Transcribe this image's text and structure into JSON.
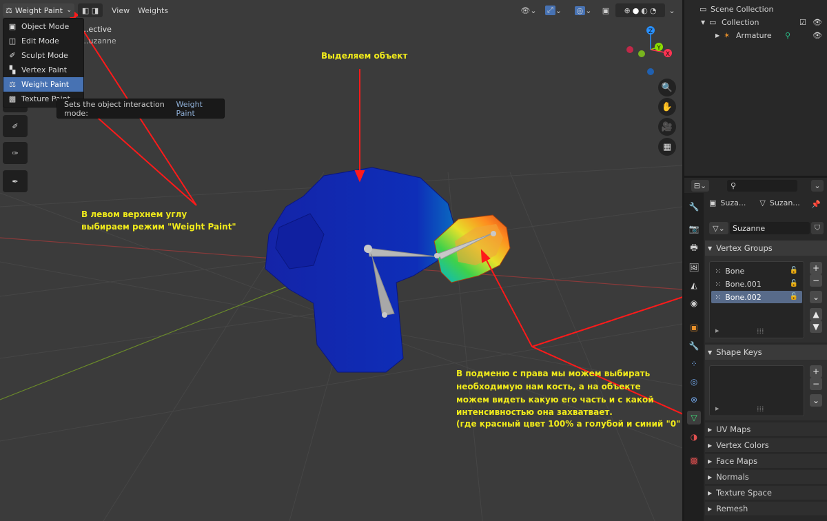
{
  "header": {
    "mode_label": "Weight Paint",
    "menus": [
      "View",
      "Weights"
    ]
  },
  "mode_menu": {
    "items": [
      {
        "label": "Object Mode",
        "icon": "object-mode-icon",
        "selected": false
      },
      {
        "label": "Edit Mode",
        "icon": "edit-mode-icon",
        "selected": false
      },
      {
        "label": "Sculpt Mode",
        "icon": "sculpt-mode-icon",
        "selected": false
      },
      {
        "label": "Vertex Paint",
        "icon": "vertex-paint-icon",
        "selected": false
      },
      {
        "label": "Weight Paint",
        "icon": "weight-paint-icon",
        "selected": true
      },
      {
        "label": "Texture Paint",
        "icon": "texture-paint-icon",
        "selected": false
      }
    ]
  },
  "tooltip": {
    "text": "Sets the object interaction mode:",
    "value": "Weight Paint"
  },
  "viewport_overlay": {
    "view_name": "...ective",
    "object_name": "...uzanne"
  },
  "gizmo": {
    "axes": [
      "Z",
      "Y",
      "X"
    ],
    "colors": {
      "x": "#ff3352",
      "y": "#8bdc00",
      "z": "#2890ff"
    }
  },
  "annotations": {
    "select_object": "Выделяем объект",
    "mode_hint_line1": "В левом верхнем углу",
    "mode_hint_line2": "выбираем режим \"Weight Paint\"",
    "submenu_hint": [
      "В подменю с права мы можем выбирать",
      "необходимую нам кость, а на объекте",
      "можем видеть какую его часть и с какой",
      "интенсивностью она захватвает.",
      "(где красный цвет 100% а голубой и синий \"0\""
    ],
    "arrow_color": "#ff1a1a",
    "text_color": "#f0ea1b"
  },
  "outliner": {
    "scene_collection": "Scene Collection",
    "collection": "Collection",
    "armature": "Armature"
  },
  "properties": {
    "breadcrumb_object": "Suza...",
    "breadcrumb_mesh": "Suzan...",
    "mesh_name": "Suzanne",
    "vertex_groups_label": "Vertex Groups",
    "vertex_groups": [
      {
        "name": "Bone",
        "selected": false
      },
      {
        "name": "Bone.001",
        "selected": false
      },
      {
        "name": "Bone.002",
        "selected": true
      }
    ],
    "shape_keys_label": "Shape Keys",
    "collapsed_panels": [
      "UV Maps",
      "Vertex Colors",
      "Face Maps",
      "Normals",
      "Texture Space",
      "Remesh"
    ]
  }
}
